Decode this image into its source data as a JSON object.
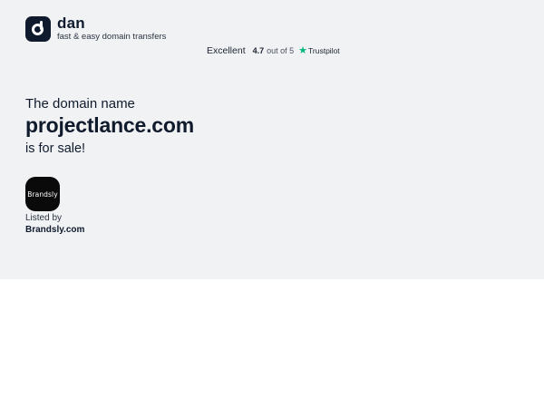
{
  "brand": {
    "name": "dan",
    "tagline": "fast & easy domain transfers"
  },
  "trustpilot": {
    "rating_word": "Excellent",
    "score": "4.7",
    "out_of": "out of 5",
    "platform": "Trustpilot",
    "star_color": "#00b67a"
  },
  "listing": {
    "intro": "The domain name",
    "domain": "projectlance.com",
    "status": "is for sale!",
    "seller_badge": "Brandsly",
    "listed_by_label": "Listed by",
    "seller": "Brandsly.com"
  },
  "colors": {
    "hero_background": "#f1f2f4",
    "text_primary": "#0f1b2d"
  }
}
